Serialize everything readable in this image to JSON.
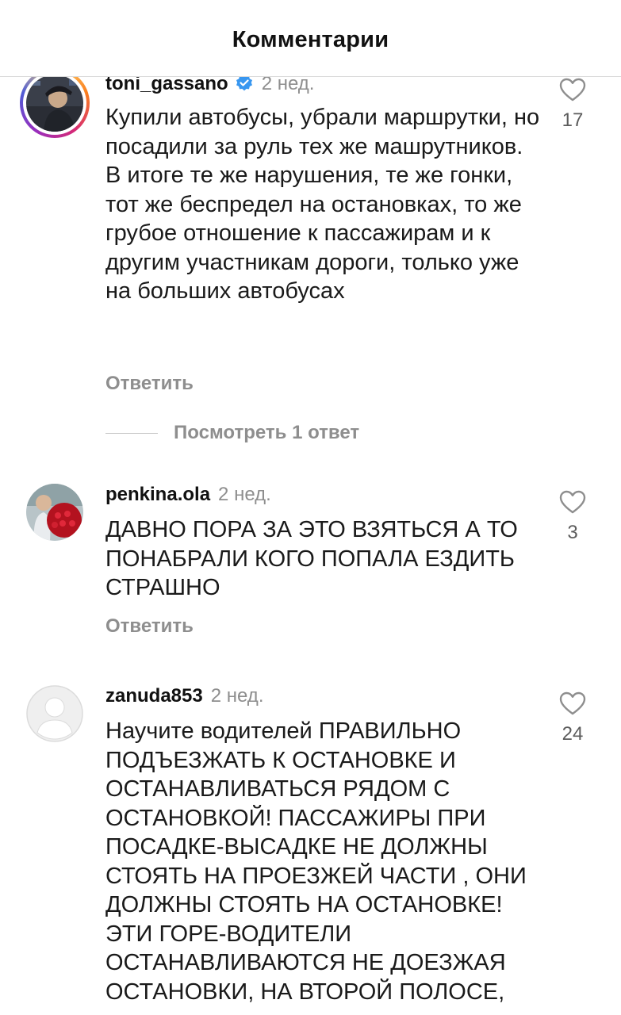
{
  "header": {
    "title": "Комментарии"
  },
  "comments": [
    {
      "username": "toni_gassano",
      "verified": true,
      "time": "2 нед.",
      "text": "Купили автобусы, убрали маршрутки, но посадили за руль тех же машрутников.\nВ итоге те же нарушения, те же гонки, тот же беспредел на остановках, то же грубое отношение к пассажирам и к другим участникам дороги, только уже на больших автобусах",
      "reply_label": "Ответить",
      "likes": "17",
      "view_replies": "Посмотреть 1 ответ"
    },
    {
      "username": "penkina.ola",
      "verified": false,
      "time": "2 нед.",
      "text": "ДАВНО ПОРА ЗА ЭТО ВЗЯТЬСЯ А ТО ПОНАБРАЛИ КОГО ПОПАЛА ЕЗДИТЬ СТРАШНО",
      "reply_label": "Ответить",
      "likes": "3"
    },
    {
      "username": "zanuda853",
      "verified": false,
      "time": "2 нед.",
      "text": "Научите водителей ПРАВИЛЬНО ПОДЪЕЗЖАТЬ К ОСТАНОВКЕ  И ОСТАНАВЛИВАТЬСЯ РЯДОМ С ОСТАНОВКОЙ! ПАССАЖИРЫ ПРИ ПОСАДКЕ-ВЫСАДКЕ НЕ ДОЛЖНЫ СТОЯТЬ НА ПРОЕЗЖЕЙ ЧАСТИ , ОНИ ДОЛЖНЫ СТОЯТЬ НА ОСТАНОВКЕ! ЭТИ ГОРЕ-ВОДИТЕЛИ ОСТАНАВЛИВАЮТСЯ НЕ ДОЕЗЖАЯ ОСТАНОВКИ, НА ВТОРОЙ ПОЛОСЕ,",
      "likes": "24"
    }
  ],
  "colors": {
    "verified": "#3897f0",
    "secondary_text": "#8e8e8e",
    "divider": "#dbdbdb"
  },
  "icons": {
    "like": "heart-outline-icon",
    "verified": "verified-badge-icon"
  }
}
